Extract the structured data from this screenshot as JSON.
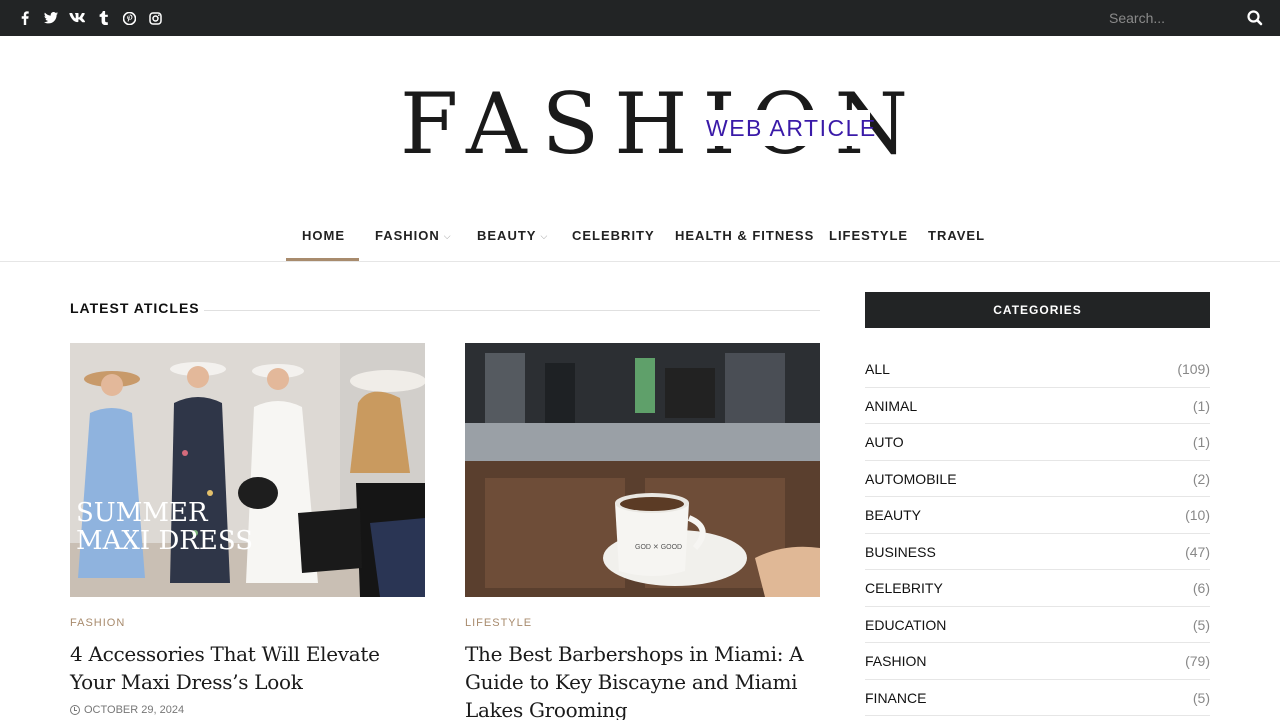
{
  "topbar": {
    "social_icons": [
      {
        "name": "facebook-icon",
        "glyph": "f"
      },
      {
        "name": "twitter-icon",
        "glyph": "🐦"
      },
      {
        "name": "vk-icon",
        "glyph": "vk"
      },
      {
        "name": "tumblr-icon",
        "glyph": "t"
      },
      {
        "name": "pinterest-icon",
        "glyph": "P"
      },
      {
        "name": "instagram-icon",
        "glyph": "◎"
      }
    ],
    "search_placeholder": "Search...",
    "search_icon": "search-icon"
  },
  "logo": {
    "main": "FASHION",
    "badge": "WEB ARTICLE",
    "badge_color": "#3a1aa8"
  },
  "nav": {
    "items": [
      {
        "label": "HOME",
        "active": true
      },
      {
        "label": "FASHION",
        "dropdown": true
      },
      {
        "label": "BEAUTY",
        "dropdown": true
      },
      {
        "label": "CELEBRITY"
      },
      {
        "label": "HEALTH & FITNESS"
      },
      {
        "label": "LIFESTYLE"
      },
      {
        "label": "TRAVEL"
      }
    ],
    "accent": "#a88b6d"
  },
  "main": {
    "section_title": "LATEST ATICLES",
    "articles": [
      {
        "category": "FASHION",
        "title": "4 Accessories That Will Elevate Your Maxi Dress’s Look",
        "date": "OCTOBER 29, 2024",
        "image_overlay": [
          "SUMMER",
          "MAXI DRESS"
        ]
      },
      {
        "category": "LIFESTYLE",
        "title": "The Best Barbershops in Miami: A Guide to Key Biscayne and Miami Lakes Grooming",
        "date": "",
        "image_overlay_cup": "GOD ✕ GOOD"
      }
    ]
  },
  "sidebar": {
    "header": "CATEGORIES",
    "categories": [
      {
        "name": "ALL",
        "count": "(109)"
      },
      {
        "name": "ANIMAL",
        "count": "(1)"
      },
      {
        "name": "AUTO",
        "count": "(1)"
      },
      {
        "name": "AUTOMOBILE",
        "count": "(2)"
      },
      {
        "name": "BEAUTY",
        "count": "(10)"
      },
      {
        "name": "BUSINESS",
        "count": "(47)"
      },
      {
        "name": "CELEBRITY",
        "count": "(6)"
      },
      {
        "name": "EDUCATION",
        "count": "(5)"
      },
      {
        "name": "FASHION",
        "count": "(79)"
      },
      {
        "name": "FINANCE",
        "count": "(5)"
      }
    ]
  }
}
